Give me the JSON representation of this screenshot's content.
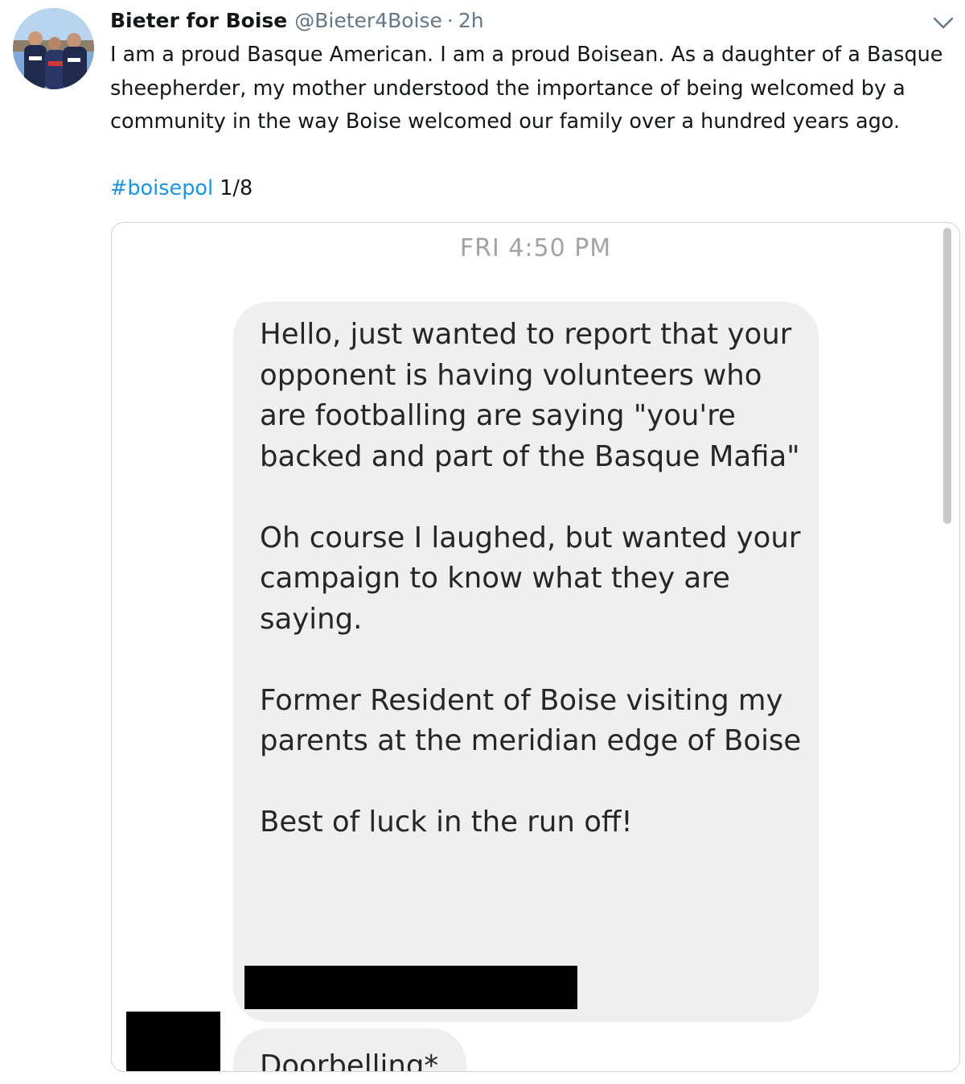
{
  "tweet": {
    "author": {
      "display_name": "Bieter for Boise",
      "handle": "@Bieter4Boise",
      "separator": "·",
      "time": "2h",
      "avatar_icon": "campaign-group-photo-avatar"
    },
    "menu_icon": "chevron-down-icon",
    "text": "I am a proud Basque American. I am a proud Boisean. As a daughter of a Basque sheepherder, my mother understood the importance of being welcomed by a community in the way Boise welcomed our family over a hundred years ago.",
    "hashtag": "#boisepol",
    "thread_counter": "1/8",
    "colors": {
      "link": "#1b95e0",
      "secondary_text": "#657786"
    }
  },
  "attached_image": {
    "timestamp": "FRI 4:50 PM",
    "message_paragraphs": [
      "Hello, just wanted to report that your opponent is having volunteers who are footballing are saying \"you're backed and part of the Basque Mafia\"",
      "Oh course I laughed, but wanted your campaign to know what they are saying.",
      "Former Resident of Boise visiting my parents at the meridian edge of Boise",
      "Best of luck in the run off!"
    ],
    "followup_message": "Doorbelling*",
    "redactions": [
      "sender-name-redacted",
      "sender-avatar-redacted"
    ],
    "colors": {
      "bubble": "#efefef",
      "bubble_text": "#262626",
      "timestamp": "#a3a3a3"
    }
  }
}
